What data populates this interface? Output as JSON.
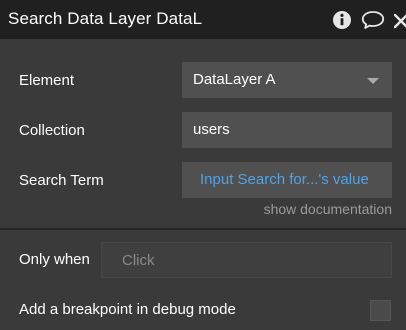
{
  "header": {
    "title": "Search Data Layer DataL"
  },
  "fields": {
    "element": {
      "label": "Element",
      "value": "DataLayer A"
    },
    "collection": {
      "label": "Collection",
      "value": "users"
    },
    "search_term": {
      "label": "Search Term",
      "value": "Input Search for...'s value"
    }
  },
  "documentation_link": "show documentation",
  "only_when": {
    "label": "Only when",
    "placeholder": "Click"
  },
  "breakpoint": {
    "label": "Add a breakpoint in debug mode",
    "checked": false
  },
  "colors": {
    "header_bg": "#202020",
    "panel_bg": "#3a3a3a",
    "field_bg": "#505050",
    "link_blue": "#4fa3e6"
  },
  "icons": [
    "info-icon",
    "chat-bubble-icon",
    "close-icon",
    "chevron-down-icon"
  ]
}
